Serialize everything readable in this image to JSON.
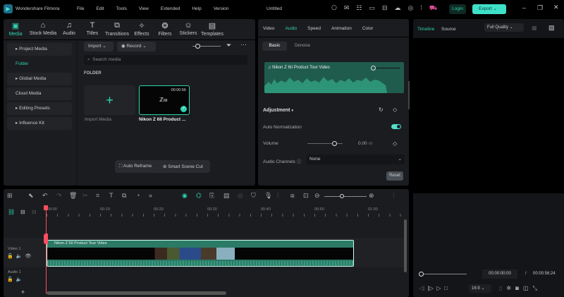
{
  "app": {
    "title": "Wondershare Filmora",
    "doc_title": "Untitled",
    "menu": [
      "File",
      "Edit",
      "Tools",
      "View",
      "Extended",
      "Help",
      "Version"
    ],
    "login": "Login",
    "export": "Export"
  },
  "toolbar": [
    {
      "label": "Media",
      "icon": "media-icon"
    },
    {
      "label": "Stock Media",
      "icon": "stock-icon"
    },
    {
      "label": "Audio",
      "icon": "music-icon"
    },
    {
      "label": "Titles",
      "icon": "text-icon"
    },
    {
      "label": "Transitions",
      "icon": "transition-icon"
    },
    {
      "label": "Effects",
      "icon": "effects-icon"
    },
    {
      "label": "Filters",
      "icon": "filters-icon"
    },
    {
      "label": "Stickers",
      "icon": "sticker-icon"
    },
    {
      "label": "Templates",
      "icon": "template-icon"
    }
  ],
  "sidebar": {
    "items": [
      "Project Media",
      "Folder",
      "Global Media",
      "Cloud Media",
      "Editing Presets",
      "Influence Kit"
    ]
  },
  "media": {
    "import": "Import",
    "record": "Record",
    "search_placeholder": "Search media",
    "folder_label": "FOLDER",
    "import_media": "Import Media",
    "clip_name": "Nikon Z 6II Product ...",
    "clip_duration": "00:00:56",
    "auto_reframe": "Auto Reframe",
    "smart_scene_cut": "Smart Scene Cut"
  },
  "props": {
    "tabs": [
      "Video",
      "Audio",
      "Speed",
      "Animation",
      "Color"
    ],
    "subtabs": [
      "Basic",
      "Denoise"
    ],
    "track_name": "Nikon Z 6II Product Tour Video",
    "adjustment": "Adjustment",
    "auto_normalization": "Auto Normalization",
    "auto_normalization_on": true,
    "volume_label": "Volume",
    "volume_value": "0.00",
    "volume_unit": "dB",
    "channels_label": "Audio Channels",
    "channels_value": "None",
    "reset": "Reset"
  },
  "preview": {
    "tabs": [
      "Timeline",
      "Source"
    ],
    "quality": "Full Quality",
    "current_time": "00:00:00:00",
    "separator": "/",
    "total_time": "00:00:56:24",
    "ratio": "16:9"
  },
  "timeline": {
    "ruler": [
      "00:00",
      "00:10",
      "00:20",
      "00:30",
      "00:40",
      "00:50",
      "01:00"
    ],
    "tracks": [
      "Video 1",
      "Audio 1"
    ],
    "clip_title": "Nikon Z 6II Product Tour Video"
  },
  "colors": {
    "accent": "#2ed3b0",
    "clip": "#2b7a66"
  }
}
